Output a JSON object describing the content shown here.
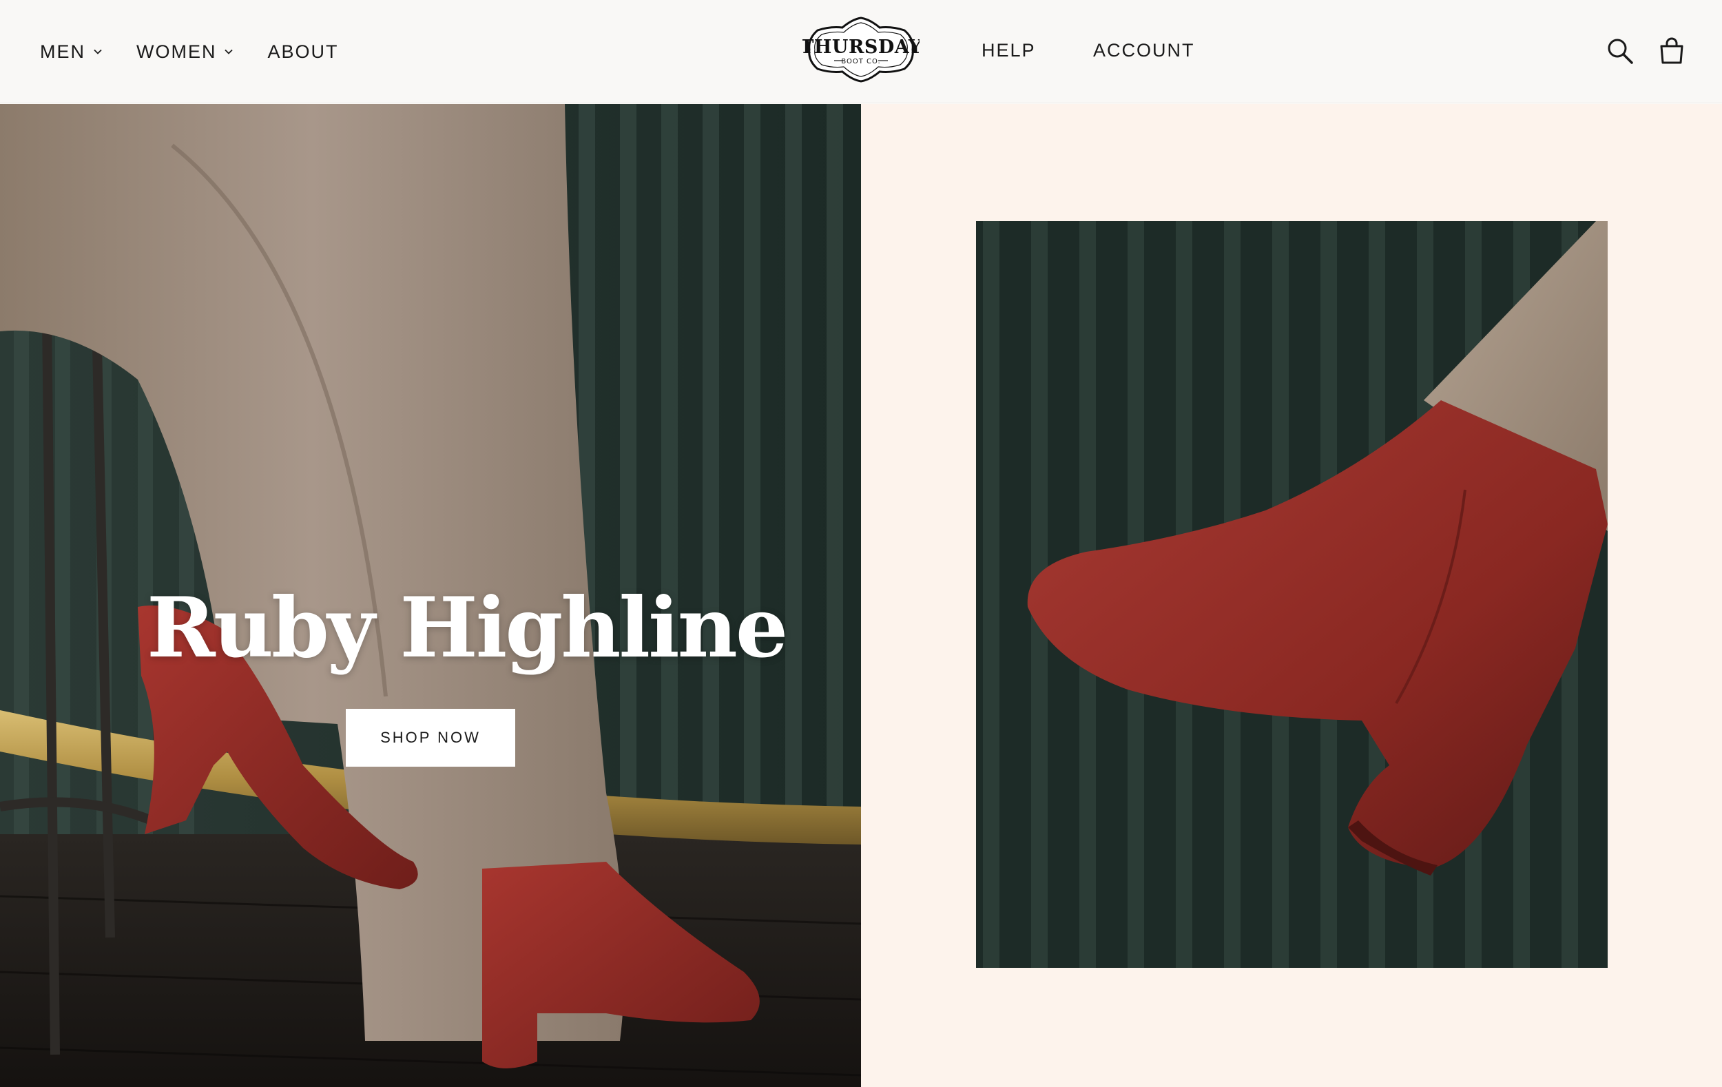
{
  "header": {
    "nav_left": [
      {
        "label": "MEN",
        "has_dropdown": true
      },
      {
        "label": "WOMEN",
        "has_dropdown": true
      },
      {
        "label": "ABOUT",
        "has_dropdown": false
      }
    ],
    "logo": {
      "line1": "THURSDAY",
      "line2": "BOOT CO."
    },
    "nav_right": [
      {
        "label": "HELP"
      },
      {
        "label": "ACCOUNT"
      }
    ],
    "icons": [
      "search-icon",
      "cart-icon"
    ]
  },
  "hero": {
    "title": "Ruby Highline",
    "cta_label": "SHOP NOW"
  },
  "colors": {
    "boot_red": "#8e2a25",
    "trousers": "#a3917f",
    "wall_green": "#1f322c",
    "brass": "#b89a4e",
    "right_panel_bg": "#fdf3ec"
  }
}
